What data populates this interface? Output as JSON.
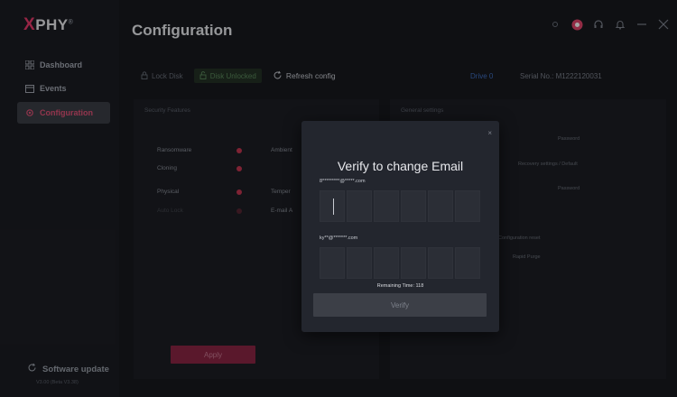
{
  "app": {
    "logo": "PHY",
    "logo_mark": "®"
  },
  "sidebar": {
    "items": [
      {
        "label": "Dashboard",
        "icon": "grid-icon"
      },
      {
        "label": "Events",
        "icon": "calendar-icon"
      },
      {
        "label": "Configuration",
        "icon": "gear-icon",
        "active": true
      }
    ],
    "software_update": "Software update",
    "version": "V3.00 (Beta V3.38)"
  },
  "header": {
    "title": "Configuration",
    "icons": [
      "status-dot-icon",
      "record-icon",
      "headset-icon",
      "bell-icon",
      "minimize-icon",
      "close-icon"
    ]
  },
  "toolbar": {
    "lock_disk": "Lock Disk",
    "disk_unlocked": "Disk Unlocked",
    "refresh": "Refresh config",
    "drive": "Drive 0",
    "serial": "Serial No.: M1222120031"
  },
  "security": {
    "title": "Security Features",
    "features": [
      "Ransomware",
      "Cloning",
      "Physical",
      "Auto Lock"
    ],
    "features_right": [
      "Ambient",
      "Temper",
      "E-mail A"
    ],
    "apply": "Apply"
  },
  "general": {
    "title": "General settings",
    "labels": [
      "Password",
      "Recovery settings / Default",
      "Password"
    ],
    "config_reset": "Configuration reset",
    "rapid_purge": "Rapid Purge"
  },
  "modal": {
    "close": "×",
    "title": "Verify to change Email",
    "current_email": "8*********@*****.com",
    "new_email": "ky**@*******.com",
    "remaining": "Remaining Time: 118",
    "verify": "Verify"
  },
  "colors": {
    "accent": "#e25277",
    "apply": "#8a2644",
    "drive": "#3f6fc1"
  }
}
